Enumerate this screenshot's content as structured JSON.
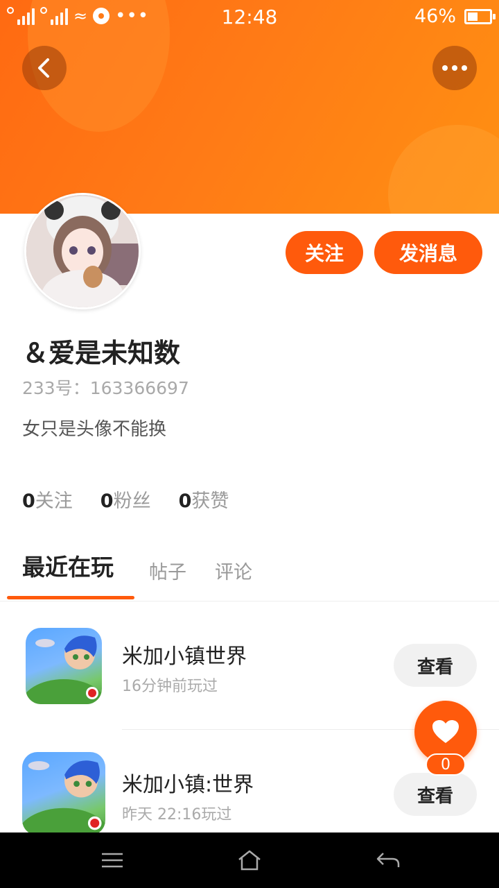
{
  "status_bar": {
    "time": "12:48",
    "battery_percent": "46%",
    "battery_level": 0.46,
    "icons": [
      "signal-icon",
      "signal-icon",
      "wifi-icon",
      "media-icon",
      "more-dots-icon"
    ]
  },
  "header": {
    "back_icon": "chevron-left-icon",
    "more_icon": "more-horizontal-icon",
    "accent_color": "#ff5a0c"
  },
  "profile": {
    "name": "＆爱是未知数",
    "uid_label": "233号：163366697",
    "bio": "女只是头像不能换",
    "follow_button": "关注",
    "message_button": "发消息"
  },
  "stats": [
    {
      "count": "0",
      "label": "关注"
    },
    {
      "count": "0",
      "label": "粉丝"
    },
    {
      "count": "0",
      "label": "获赞"
    }
  ],
  "tabs": [
    {
      "label": "最近在玩",
      "active": true
    },
    {
      "label": "帖子",
      "active": false
    },
    {
      "label": "评论",
      "active": false
    }
  ],
  "games": [
    {
      "title": "米加小镇世界",
      "subtitle": "16分钟前玩过",
      "action": "查看"
    },
    {
      "title": "米加小镇:世界",
      "subtitle": "昨天 22:16玩过",
      "action": "查看"
    }
  ],
  "like_fab": {
    "icon": "heart-icon",
    "count": "0"
  },
  "nav_bar": {
    "icons": [
      "menu-icon",
      "home-icon",
      "back-arrow-icon"
    ]
  }
}
